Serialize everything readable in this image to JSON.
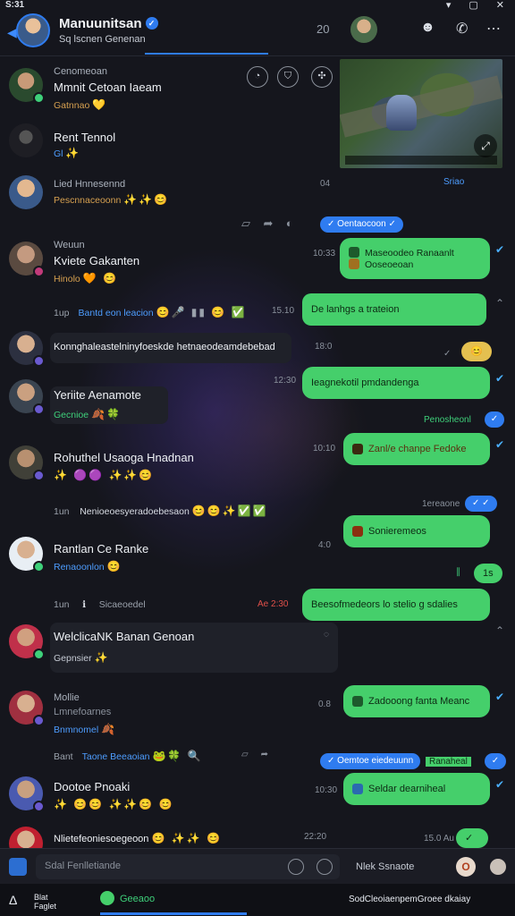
{
  "status": {
    "time": "S:31",
    "icons": [
      "wifi-icon",
      "square-icon",
      "close-icon"
    ]
  },
  "header": {
    "title": "Manuunitsan",
    "subtitle": "Sq lscnen Genenan",
    "count": "20"
  },
  "chats": [
    {
      "name": "Cenomeoan",
      "sub": "Mmnit Cetoan Iaeam",
      "time": "",
      "meta": "Gatnnao"
    },
    {
      "name": "Rent Tennol",
      "sub": "Gl",
      "time": "",
      "meta": ""
    },
    {
      "name": "Lied Hnnesennd",
      "sub": "Pescnnaceoonn",
      "time": "04",
      "meta": ""
    },
    {
      "name": "Weuun",
      "sub": "Kviete Gakanten",
      "time": "10:33",
      "meta": "Hinolo"
    },
    {
      "name": "1up",
      "sub": "Bantd eon leacion",
      "time": "15.10",
      "meta": ""
    },
    {
      "name": "Konnghaleastelninyfoeskde hetnaeodeamdebebad",
      "sub": "",
      "time": "18:0",
      "meta": ""
    },
    {
      "name": "Yeriite Aenamote",
      "sub": "Gecnioe",
      "time": "12:30",
      "meta": ""
    },
    {
      "name": "Rohuthel Usaoga Hnadnan",
      "sub": "",
      "time": "10:10",
      "meta": ""
    },
    {
      "name": "1un",
      "sub": "Nenioeoesyeradoebesaon",
      "time": "",
      "meta": ""
    },
    {
      "name": "Rantlan Ce Ranke",
      "sub": "Renaoonlon",
      "time": "4:0",
      "meta": ""
    },
    {
      "name": "1un",
      "sub": "Sicaeoedel",
      "time": "2:30",
      "meta": ""
    },
    {
      "name": "WelclicaNK Banan Genoan",
      "sub": "Gepnsier",
      "time": "",
      "meta": ""
    },
    {
      "name": "Mollie",
      "sub": "Lmnefoarnes",
      "time": "0.8",
      "meta": "Bnmnomel"
    },
    {
      "name": "Bant",
      "sub": "Taone Beeaoian",
      "time": "",
      "meta": ""
    },
    {
      "name": "Dootoe Pnoaki",
      "sub": "",
      "time": "10:30",
      "meta": ""
    },
    {
      "name": "Nlietefeoniesoegeoon",
      "sub": "",
      "time": "22:20",
      "meta": ""
    }
  ],
  "right": {
    "sriao": "Sriao",
    "blue1": "Oentaocoon",
    "b1_line1": "Maseoodeo Ranaanlt",
    "b1_line2": "Ooseoeoan",
    "b2": "De lanhgs a trateion",
    "b3": "Ieagnekotil pmdandenga",
    "g1": "Penosheonl",
    "b4": "Zanl/e  chanpe Fedoke",
    "g2": "1ereaone",
    "b5": "Sonieremeos",
    "b6": "1s",
    "b7": "Beesofmedeors lo stelio g sdalies",
    "b8": "Zadooong fanta Meanc",
    "blue2": "Oemtoe eiedeuunn",
    "g3": "Ranaheal",
    "b9": "Seldar dearniheal",
    "g4": "15.0 Au"
  },
  "composer": {
    "placeholder": "Sdal Fenlletiande",
    "right_label": "Nlek Ssnaote",
    "btn": "O"
  },
  "bottombar": {
    "label_line1": "Blat",
    "label_line2": "Faglet",
    "active": "Geeaoo",
    "right": "SodCleoiaenpemGroee dkaiay"
  }
}
